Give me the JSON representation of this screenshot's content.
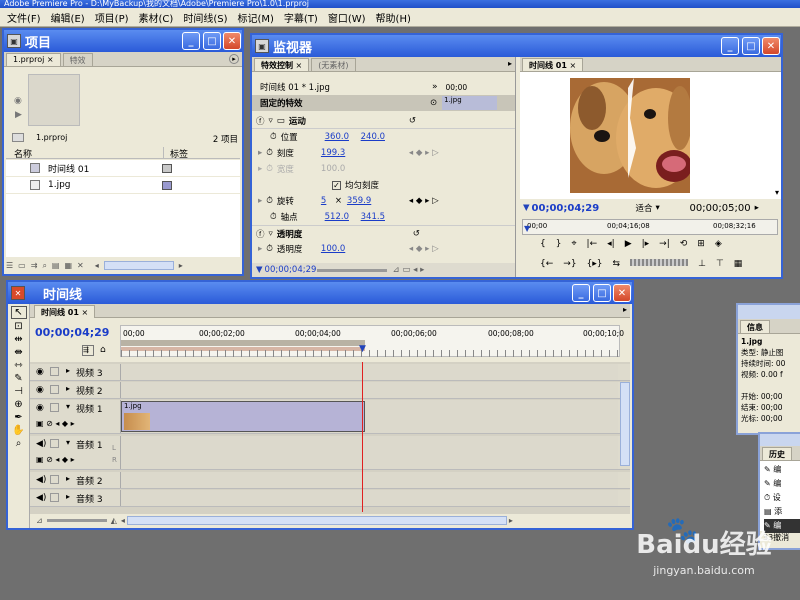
{
  "app": {
    "title_fragment": "Adobe Premiere Pro - D:\\MyBackup\\我的文档\\Adobe\\Premiere Pro\\1.0\\1.prproj"
  },
  "menu": [
    "文件(F)",
    "编辑(E)",
    "项目(P)",
    "素材(C)",
    "时间线(S)",
    "标记(M)",
    "字幕(T)",
    "窗口(W)",
    "帮助(H)"
  ],
  "project": {
    "title": "项目",
    "tabs": [
      "1.prproj",
      "特效"
    ],
    "name": "1.prproj",
    "count": "2 项目",
    "columns": [
      "名称",
      "标签"
    ],
    "items": [
      "时间线 01",
      "1.jpg"
    ]
  },
  "monitor": {
    "title": "监视器",
    "tabs": [
      "特效控制",
      "(无素材)",
      "时间线 01"
    ],
    "fx_header": "时间线 01 * 1.jpg",
    "clip_label": "1.jpg",
    "mini_tc": "00;00",
    "fixed_fx": "固定的特效",
    "motion": "运动",
    "position_label": "位置",
    "position_x": "360.0",
    "position_y": "240.0",
    "scale_label": "刻度",
    "scale_val": "199.3",
    "width_label": "宽度",
    "width_val": "100.0",
    "uniform_label": "均匀刻度",
    "rotation_label": "旋转",
    "rotation_a": "5",
    "rotation_x": "×",
    "rotation_b": "359.9",
    "anchor_label": "轴点",
    "anchor_x": "512.0",
    "anchor_y": "341.5",
    "opacity": "透明度",
    "opacity_label": "透明度",
    "opacity_val": "100.0",
    "fx_tc": "00;00;04;29",
    "prog_tc": "00;00;04;29",
    "fit": "适合",
    "prog_dur": "00;00;05;00",
    "ruler": [
      "00;00",
      "00;04;16;08",
      "00;08;32;16"
    ]
  },
  "timeline": {
    "title": "时间线",
    "tab": "时间线 01",
    "tc": "00;00;04;29",
    "ruler": [
      "00;00",
      "00;00;02;00",
      "00;00;04;00",
      "00;00;06;00",
      "00;00;08;00",
      "00;00;10;0"
    ],
    "tracks": [
      "视频 3",
      "视频 2",
      "视频 1",
      "音频 1",
      "音频 2",
      "音频 3"
    ],
    "clip": "1.jpg",
    "audio_side": [
      "L",
      "R"
    ]
  },
  "info": {
    "title": "信息",
    "clip": "1.jpg",
    "rows": [
      "类型:  静止图",
      "持续时间: 00",
      "视频:  0.00 f",
      "开始: 00;00",
      "结束: 00;00",
      "光标: 00;00"
    ]
  },
  "history": {
    "title": "历史",
    "footer": "33撤消"
  },
  "watermark": {
    "text": "Baidu经验",
    "url": "jingyan.baidu.com"
  }
}
